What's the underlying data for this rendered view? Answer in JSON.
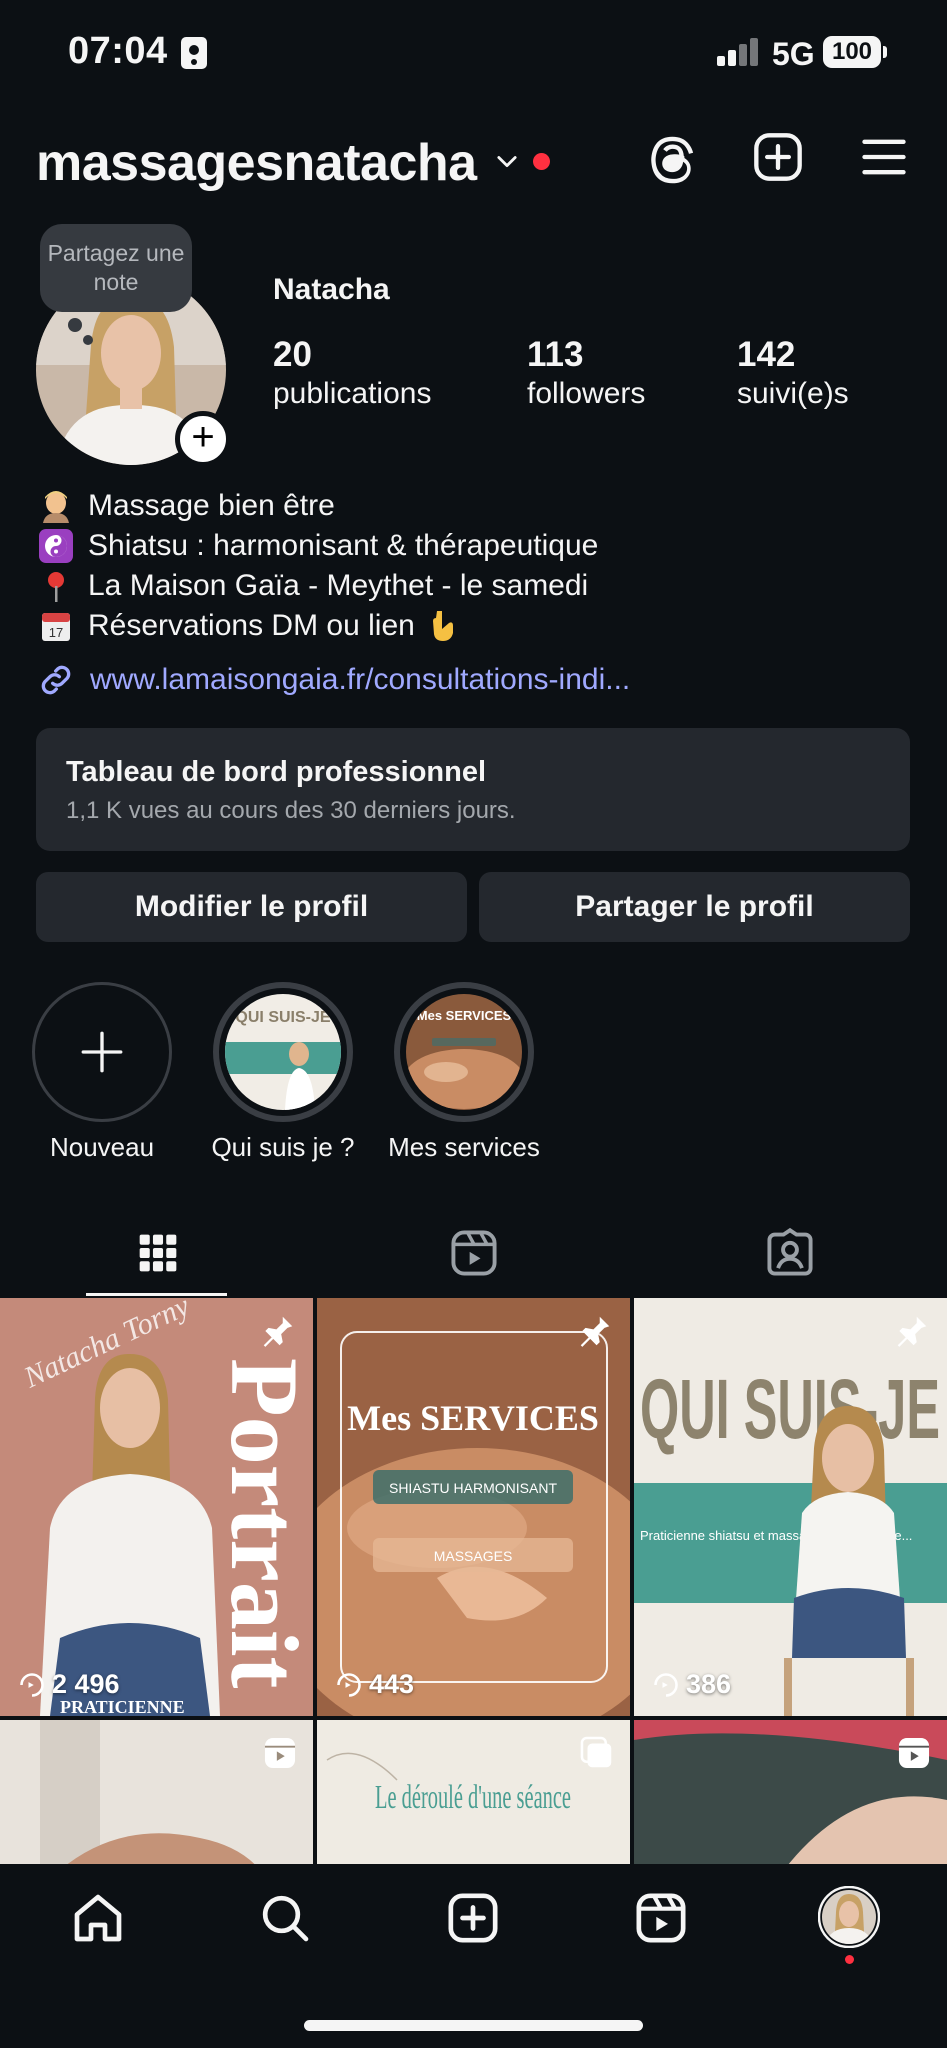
{
  "status": {
    "time": "07:04",
    "network": "5G",
    "battery": "100"
  },
  "header": {
    "username": "massagesnatacha",
    "icons": [
      "threads-icon",
      "create-icon",
      "menu-icon"
    ]
  },
  "profile": {
    "note_placeholder": "Partagez une note",
    "display_name": "Natacha",
    "stats": [
      {
        "value": "20",
        "label": "publications"
      },
      {
        "value": "113",
        "label": "followers"
      },
      {
        "value": "142",
        "label": "suivi(e)s"
      }
    ],
    "bio": [
      {
        "emoji": "massage-emoji",
        "text": "Massage bien être"
      },
      {
        "emoji": "yin-yang-emoji",
        "text": "Shiatsu : harmonisant & thérapeutique"
      },
      {
        "emoji": "pin-emoji",
        "text": "La Maison Gaïa - Meythet - le samedi"
      },
      {
        "emoji": "calendar-emoji",
        "text": "Réservations DM ou lien"
      }
    ],
    "link": "www.lamaisongaia.fr/consultations-indi..."
  },
  "dashboard": {
    "title": "Tableau de bord professionnel",
    "subtitle": "1,1 K vues au cours des 30 derniers jours."
  },
  "buttons": {
    "edit": "Modifier le profil",
    "share": "Partager le profil"
  },
  "highlights": [
    {
      "label": "Nouveau"
    },
    {
      "label": "Qui suis je ?",
      "cover_text": "QUI SUIS-JE"
    },
    {
      "label": "Mes services",
      "cover_text": "Mes SERVICES"
    }
  ],
  "grid": [
    {
      "views": "2 496",
      "pinned": true,
      "overlay_title": "Portrait",
      "overlay_sub": "PRATICIENNE",
      "script_text": "Natacha Torny"
    },
    {
      "views": "443",
      "pinned": true,
      "overlay_title": "Mes SERVICES",
      "tag1": "SHIASTU HARMONISANT",
      "tag2": "MASSAGES"
    },
    {
      "views": "386",
      "pinned": true,
      "overlay_title": "QUI SUIS-JE",
      "overlay_sub": "Praticienne shiatsu et massage mais pas que..."
    },
    {
      "type": "reel"
    },
    {
      "type": "carousel",
      "overlay_title": "Le déroulé d'une séance"
    },
    {
      "type": "reel"
    }
  ],
  "colors": {
    "background": "#0c1014",
    "surface": "#24282e",
    "link": "#a0a9ff",
    "notification": "#ff3040"
  }
}
